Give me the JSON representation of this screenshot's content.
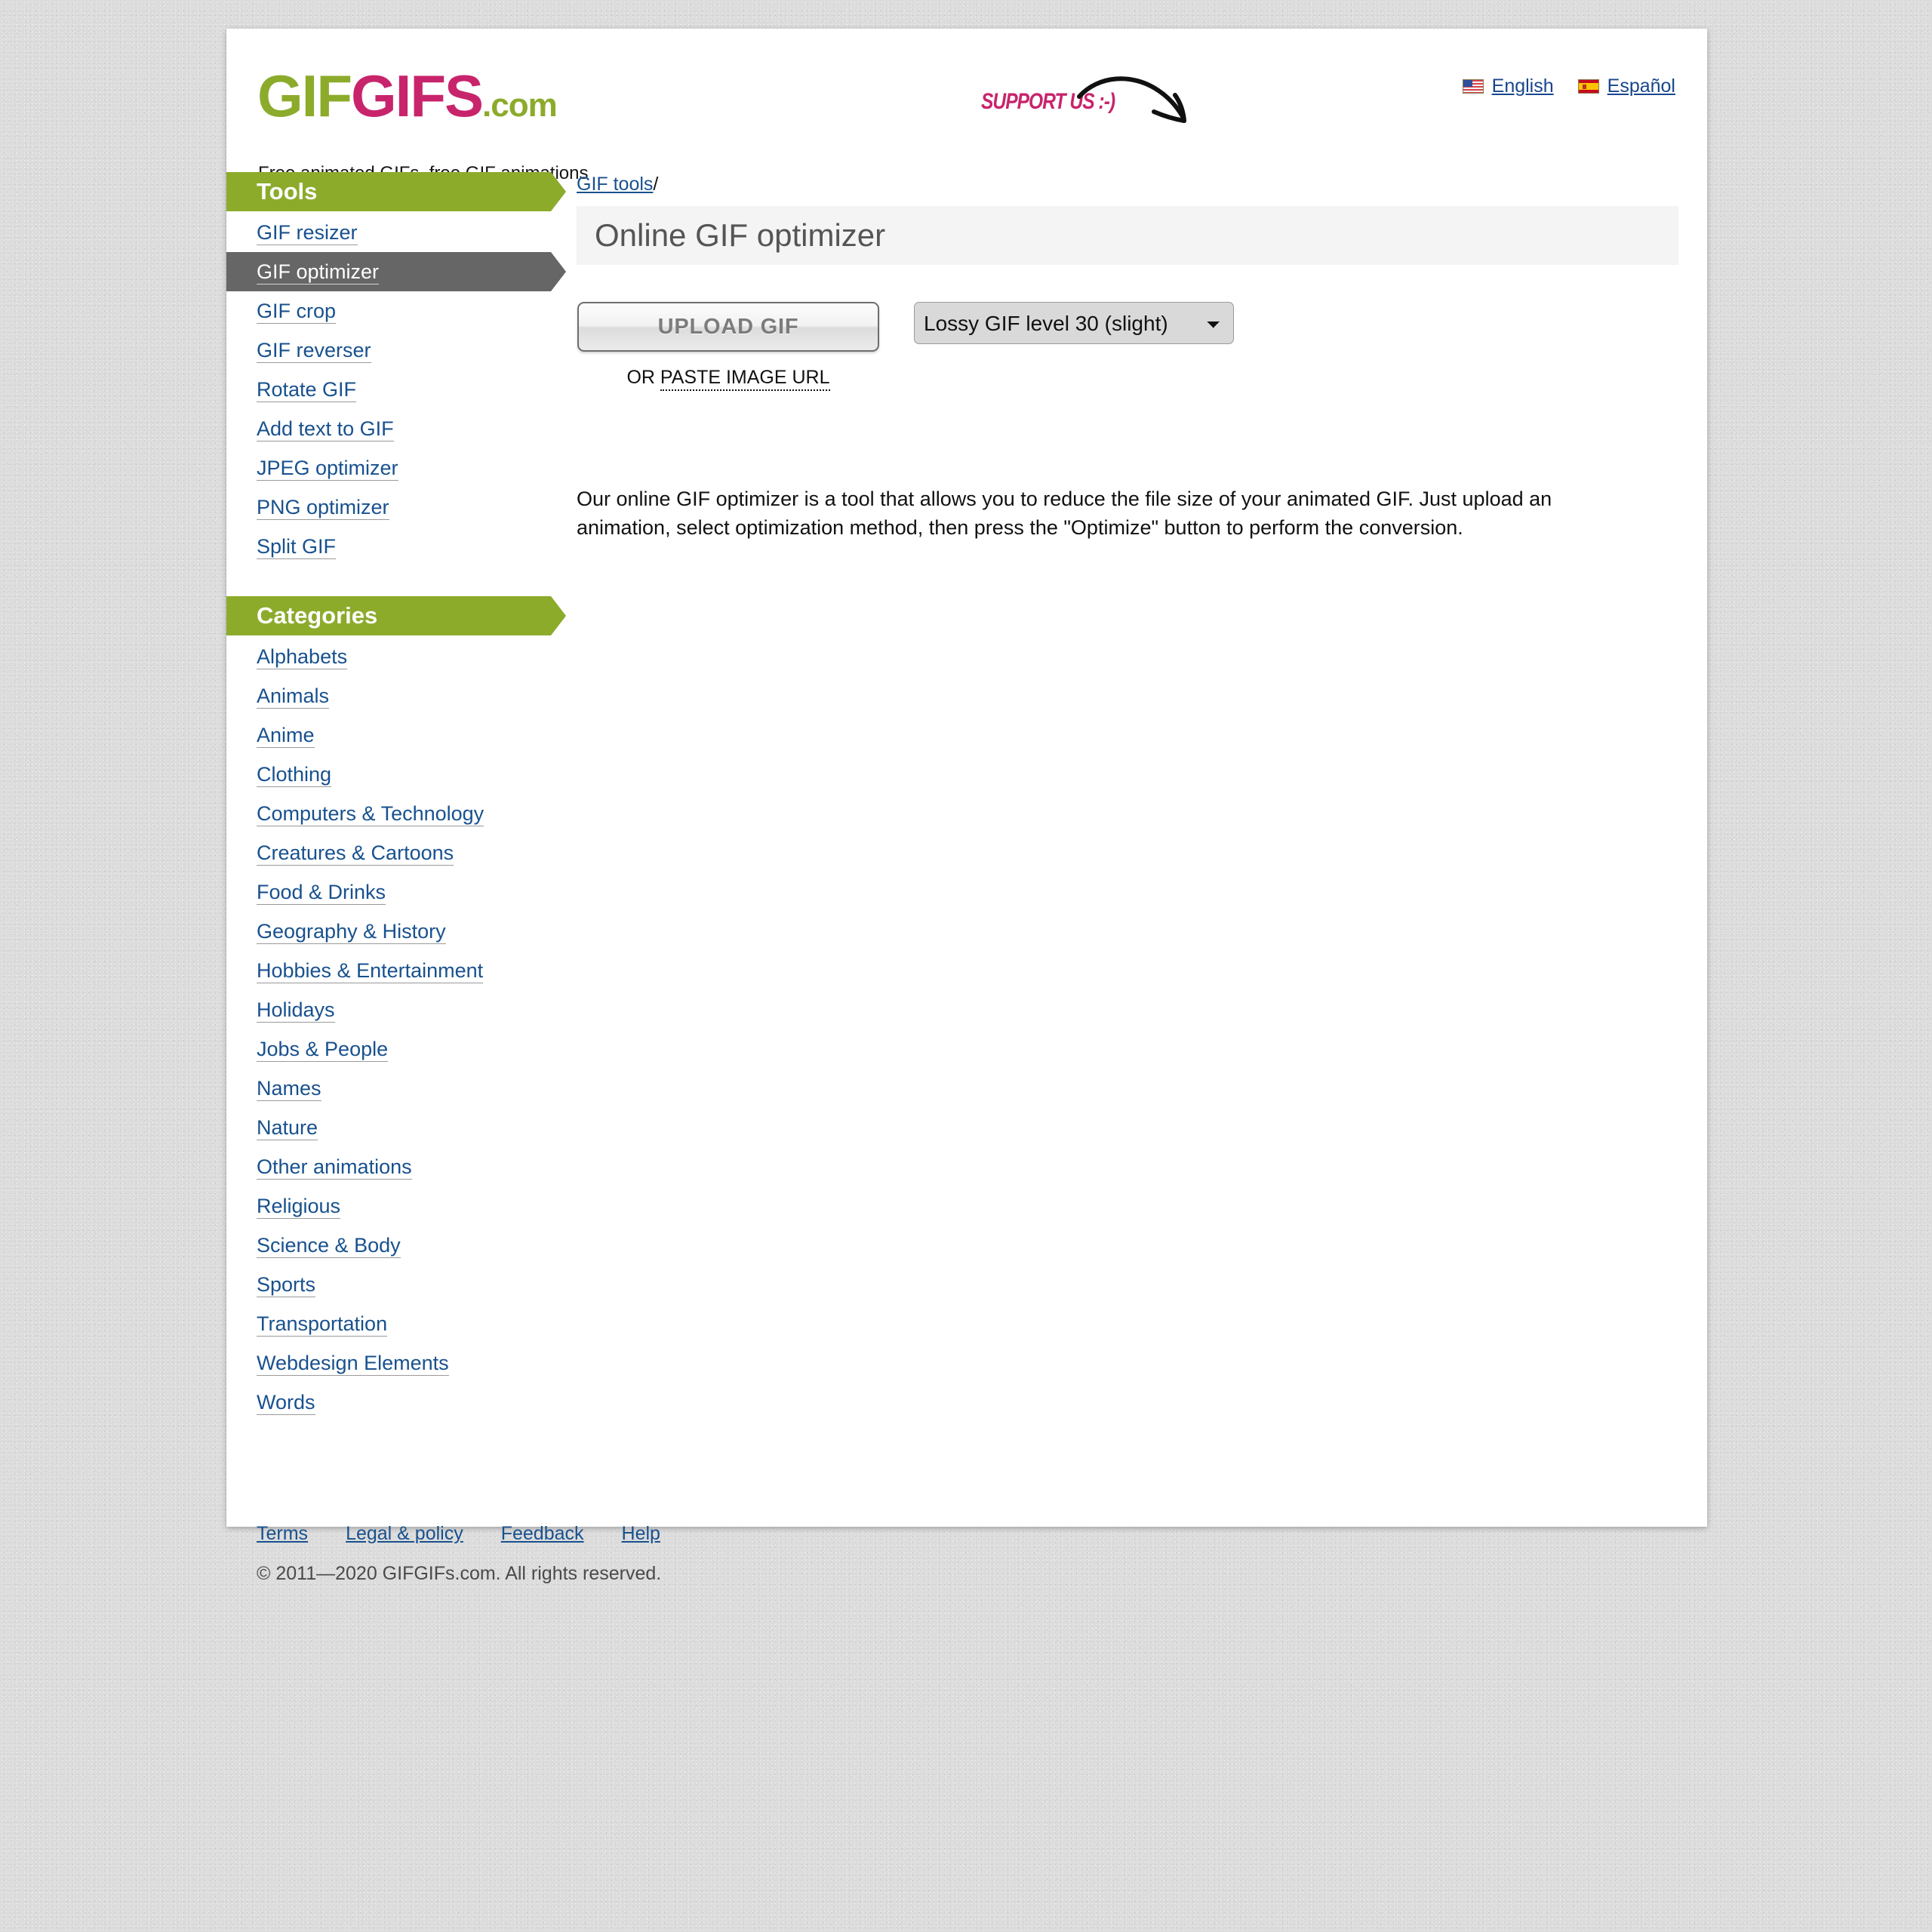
{
  "header": {
    "logo": {
      "part1": "GIF",
      "part2": "GIFS",
      "suffix": ".com"
    },
    "tagline": "Free animated GIFs, free GIF animations",
    "support_banner": {
      "text": "SUPPORT US :-)",
      "icon": "curved-arrow-icon"
    },
    "languages": [
      {
        "label": "English",
        "flag": "us-flag-icon"
      },
      {
        "label": "Español",
        "flag": "es-flag-icon"
      }
    ]
  },
  "sidebar": {
    "tools": {
      "title": "Tools",
      "items": [
        {
          "label": "GIF resizer",
          "active": false
        },
        {
          "label": "GIF optimizer",
          "active": true
        },
        {
          "label": "GIF crop",
          "active": false
        },
        {
          "label": "GIF reverser",
          "active": false
        },
        {
          "label": "Rotate GIF",
          "active": false
        },
        {
          "label": "Add text to GIF",
          "active": false
        },
        {
          "label": "JPEG optimizer",
          "active": false
        },
        {
          "label": "PNG optimizer",
          "active": false
        },
        {
          "label": "Split GIF",
          "active": false
        }
      ]
    },
    "categories": {
      "title": "Categories",
      "items": [
        {
          "label": "Alphabets"
        },
        {
          "label": "Animals"
        },
        {
          "label": "Anime"
        },
        {
          "label": "Clothing"
        },
        {
          "label": "Computers & Technology"
        },
        {
          "label": "Creatures & Cartoons"
        },
        {
          "label": "Food & Drinks"
        },
        {
          "label": "Geography & History"
        },
        {
          "label": "Hobbies & Entertainment"
        },
        {
          "label": "Holidays"
        },
        {
          "label": "Jobs & People"
        },
        {
          "label": "Names"
        },
        {
          "label": "Nature"
        },
        {
          "label": "Other animations"
        },
        {
          "label": "Religious"
        },
        {
          "label": "Science & Body"
        },
        {
          "label": "Sports"
        },
        {
          "label": "Transportation"
        },
        {
          "label": "Webdesign Elements"
        },
        {
          "label": "Words"
        }
      ]
    }
  },
  "main": {
    "breadcrumb": {
      "link": "GIF tools",
      "separator": "/"
    },
    "page_title": "Online GIF optimizer",
    "upload_button": "UPLOAD GIF",
    "or_prefix": "OR ",
    "paste_url_link": "PASTE IMAGE URL",
    "method_select": {
      "selected": "Lossy GIF level 30 (slight)",
      "options": [
        "Lossy GIF level 30 (slight)"
      ]
    },
    "description": "Our online GIF optimizer is a tool that allows you to reduce the file size of your animated GIF. Just upload an animation, select optimization method, then press the \"Optimize\" button to perform the conversion."
  },
  "footer": {
    "links": [
      {
        "label": "Terms"
      },
      {
        "label": "Legal & policy"
      },
      {
        "label": "Feedback"
      },
      {
        "label": "Help"
      }
    ],
    "copyright": "© 2011—2020 GIFGIFs.com. All rights reserved."
  },
  "colors": {
    "brand_green": "#8cab2b",
    "brand_pink": "#c8246c",
    "link_blue": "#18518e",
    "active_gray": "#666666",
    "title_band": "#f4f4f4"
  }
}
